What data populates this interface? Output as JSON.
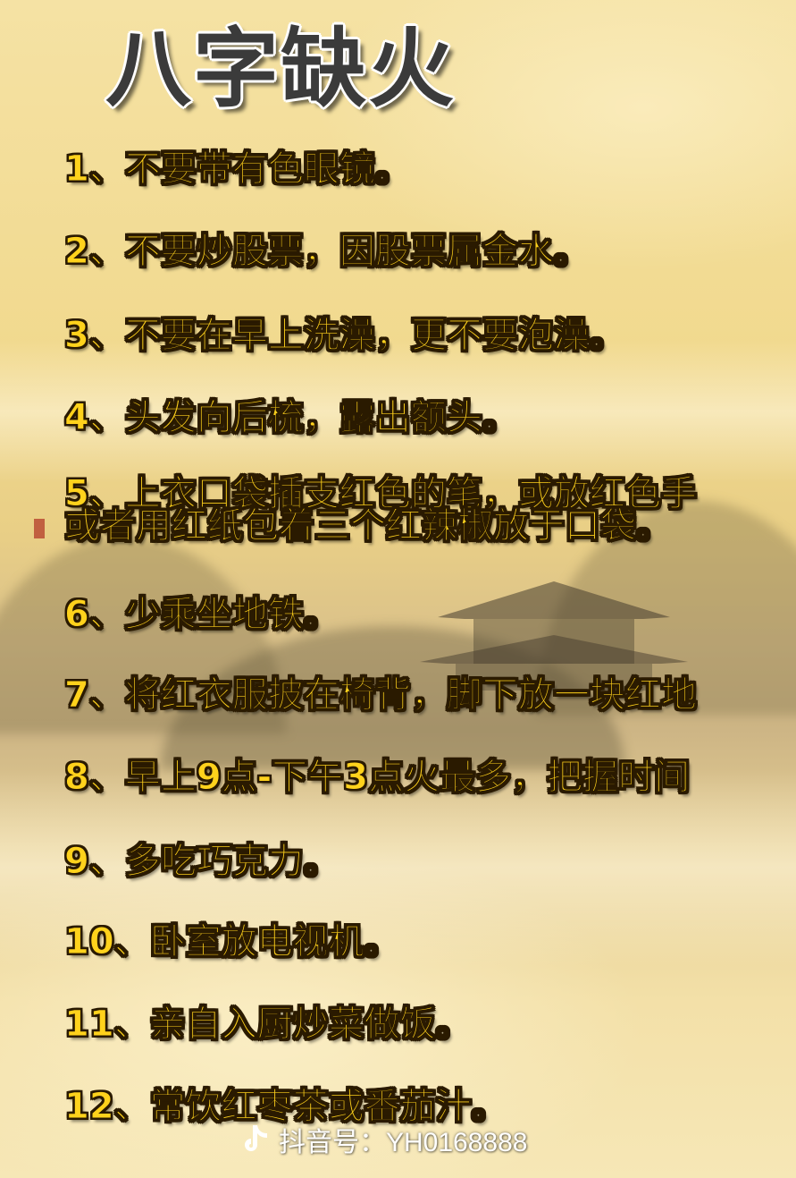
{
  "title": "八字缺火",
  "items": [
    {
      "text": "1、不要带有色眼镜。"
    },
    {
      "text": "2、不要炒股票，因股票属金水。"
    },
    {
      "text": "3、不要在早上洗澡，更不要泡澡。"
    },
    {
      "text": "4、头发向后梳，露出额头。"
    },
    {
      "line1": "5、上衣口袋插支红色的笔，或放红色手",
      "line2": "或者用红纸包着三个红辣椒放于口袋。"
    },
    {
      "text": "6、少乘坐地铁。"
    },
    {
      "text": "7、将红衣服披在椅背，脚下放一块红地"
    },
    {
      "text": "8、早上9点-下午3点火最多，把握时间"
    },
    {
      "text": "9、多吃巧克力。"
    },
    {
      "text": "10、卧室放电视机。"
    },
    {
      "text": "11、亲自入厨炒菜做饭。"
    },
    {
      "text": "12、常饮红枣茶或番茄汁。"
    }
  ],
  "watermark": {
    "icon": "tiktok-icon",
    "text": "抖音号：YH0168888"
  },
  "colors": {
    "item_text": "#ffd21c",
    "item_outline": "#2a1a00",
    "title_text": "#3b3b3b",
    "background": "#f3dc9a"
  }
}
